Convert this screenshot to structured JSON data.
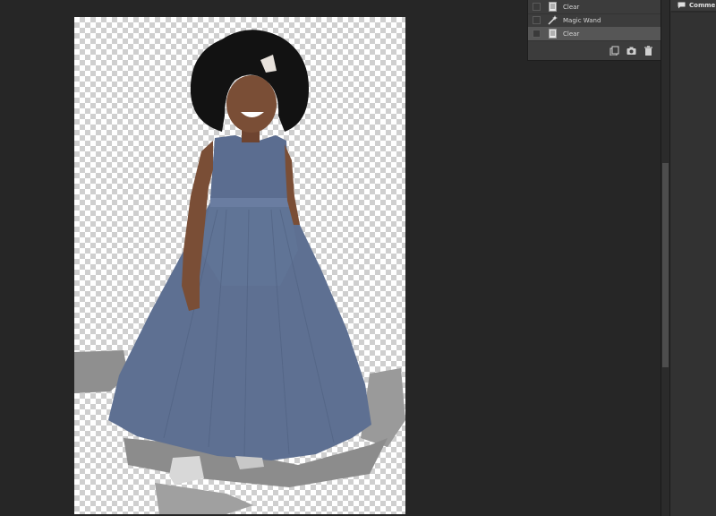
{
  "history": {
    "items": [
      {
        "label": "Clear",
        "icon": "document-icon",
        "selected": false
      },
      {
        "label": "Magic Wand",
        "icon": "magic-wand-icon",
        "selected": false
      },
      {
        "label": "Clear",
        "icon": "document-icon",
        "selected": true
      }
    ],
    "footer_icons": [
      "new-document-from-state-icon",
      "camera-snapshot-icon",
      "trash-icon"
    ]
  },
  "right_panel": {
    "tab_label": "Comme",
    "tab_icon": "comment-icon"
  },
  "colors": {
    "workspace": "#262626",
    "panel": "#3c3c3c",
    "selected_row": "#565656",
    "dress": "#5e7092",
    "hair": "#121212"
  }
}
